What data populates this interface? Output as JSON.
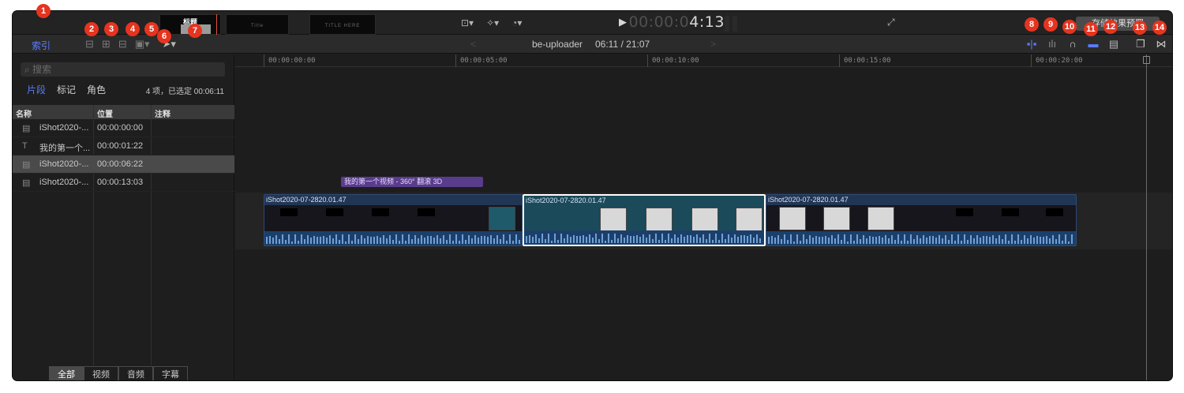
{
  "header": {
    "thumb_title": "标题",
    "thumb_small_2": "Title",
    "thumb_small_3": "TITLE HERE",
    "timecode_dim": "00:00:0",
    "timecode_bright": "4:13",
    "save_preset": "存储效果预置"
  },
  "toolbar": {
    "index_label": "索引",
    "prev": "<",
    "next": ">",
    "project_name": "be-uploader",
    "project_time": "06:11 / 21:07"
  },
  "index": {
    "search_placeholder": "搜索",
    "tabs": [
      "片段",
      "标记",
      "角色"
    ],
    "count": "4 项，已选定 00:06:11",
    "columns": [
      "名称",
      "位置",
      "注释"
    ],
    "rows": [
      {
        "name": "iShot2020-...",
        "pos": "00:00:00:00",
        "icon": "film-icon"
      },
      {
        "name": "我的第一个...",
        "pos": "00:00:01:22",
        "icon": "text-icon"
      },
      {
        "name": "iShot2020-...",
        "pos": "00:00:06:22",
        "icon": "film-icon"
      },
      {
        "name": "iShot2020-...",
        "pos": "00:00:13:03",
        "icon": "film-icon"
      }
    ],
    "bottom_filters": [
      "全部",
      "视频",
      "音频",
      "字幕"
    ]
  },
  "timeline": {
    "ruler": [
      "00:00:00:00",
      "00:00:05:00",
      "00:00:10:00",
      "00:00:15:00",
      "00:00:20:00"
    ],
    "title_clip": "我的第一个视频 - 360° 翻滚 3D",
    "clips": [
      "iShot2020-07-2820.01.47",
      "iShot2020-07-2820.01.47",
      "iShot2020-07-2820.01.47"
    ]
  },
  "badges": [
    "1",
    "2",
    "3",
    "4",
    "5",
    "6",
    "7",
    "8",
    "9",
    "10",
    "11",
    "12",
    "13",
    "14"
  ],
  "colors": {
    "accent": "#5b7bff",
    "badge": "#e6341f",
    "clip": "#213654",
    "title_clip": "#5a3c8c"
  }
}
